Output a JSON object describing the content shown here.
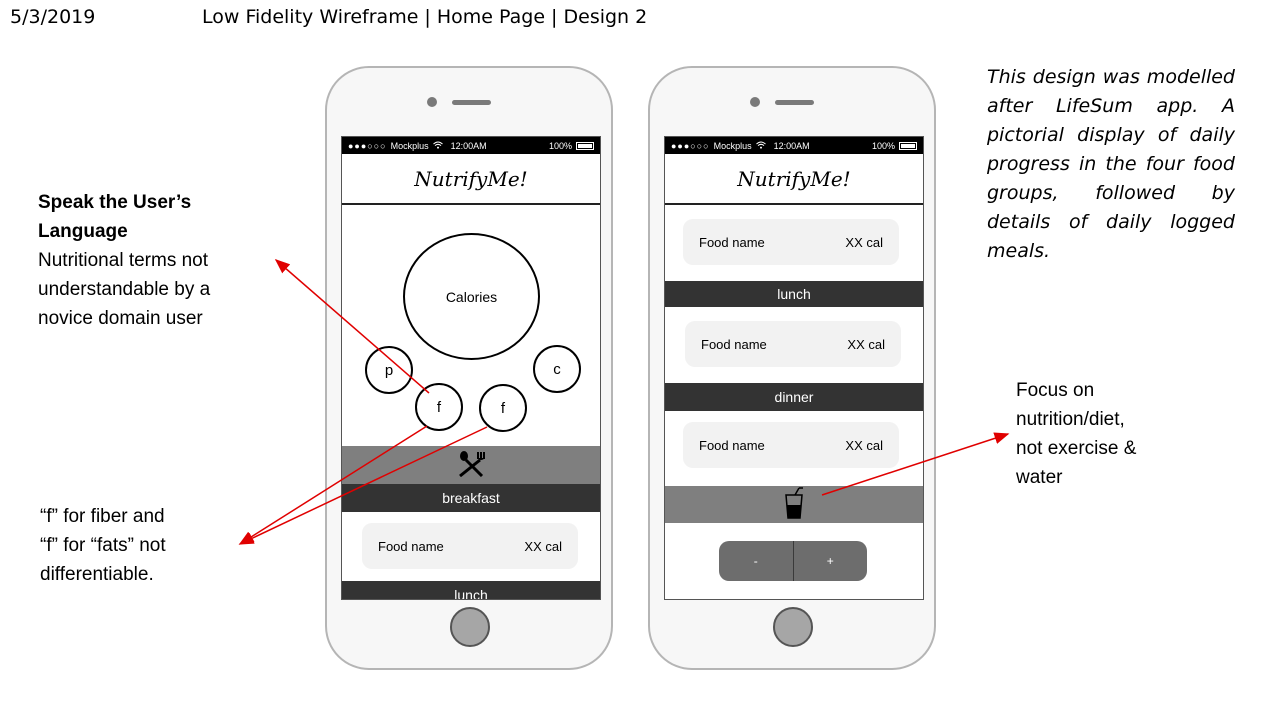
{
  "header": {
    "date": "5/3/2019",
    "title": "Low Fidelity Wireframe  | Home Page | Design 2"
  },
  "status_bar": {
    "signal": "●●●○○○",
    "carrier": "Mockplus",
    "time": "12:00AM",
    "battery": "100%"
  },
  "app": {
    "logo": "NutrifyMe!"
  },
  "phone1": {
    "calories_label": "Calories",
    "macro_p": "p",
    "macro_c": "c",
    "macro_f1": "f",
    "macro_f2": "f",
    "meal_icon": "utensils-icon",
    "breakfast_label": "breakfast",
    "food_name": "Food name",
    "food_cal": "XX cal",
    "lunch_label": "lunch"
  },
  "phone2": {
    "card1_name": "Food name",
    "card1_cal": "XX cal",
    "lunch_label": "lunch",
    "card2_name": "Food name",
    "card2_cal": "XX cal",
    "dinner_label": "dinner",
    "card3_name": "Food name",
    "card3_cal": "XX cal",
    "drink_icon": "drink-cup-icon",
    "minus_label": "-",
    "plus_label": "+"
  },
  "annotations": {
    "speak_title_1": "Speak the User’s",
    "speak_title_2": "Language",
    "speak_body_1": "Nutritional terms not",
    "speak_body_2": "understandable by a",
    "speak_body_3": "novice domain user",
    "fiber_1": "“f” for fiber and",
    "fiber_2": "“f” for “fats” not",
    "fiber_3": "differentiable.",
    "design_note": "This design was modelled after LifeSum app. A pictorial display of daily progress in the four food groups, followed by details of daily logged meals.",
    "focus_1": "Focus on",
    "focus_2": "nutrition/diet,",
    "focus_3": "not exercise &",
    "focus_4": "water"
  },
  "colors": {
    "annotation_arrow": "#e00000",
    "dark_bar": "#333333",
    "gray_bar": "#7f7f7f",
    "card_bg": "#f2f2f2"
  }
}
